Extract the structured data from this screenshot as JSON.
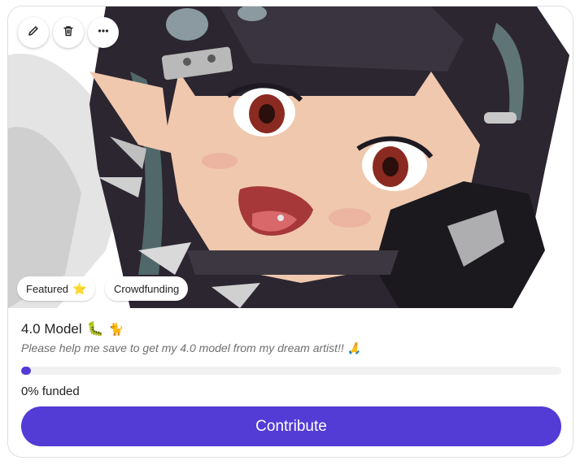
{
  "card": {
    "title": "4.0 Model",
    "title_emojis": [
      "🐛",
      "🐈"
    ],
    "description": "Please help me save to get my 4.0 model from my dream artist!!",
    "description_emoji": "🙏",
    "badges": [
      {
        "label": "Featured",
        "icon": "⭐"
      },
      {
        "label": "Crowdfunding"
      }
    ],
    "progress": {
      "fraction": 0.0,
      "label": "0% funded"
    },
    "contribute_label": "Contribute",
    "colors": {
      "accent": "#533bd6",
      "progress_track": "#f1f1f1"
    }
  },
  "actions": [
    {
      "name": "edit",
      "icon": "pencil-icon"
    },
    {
      "name": "delete",
      "icon": "trash-icon"
    },
    {
      "name": "more",
      "icon": "ellipsis-icon"
    }
  ]
}
